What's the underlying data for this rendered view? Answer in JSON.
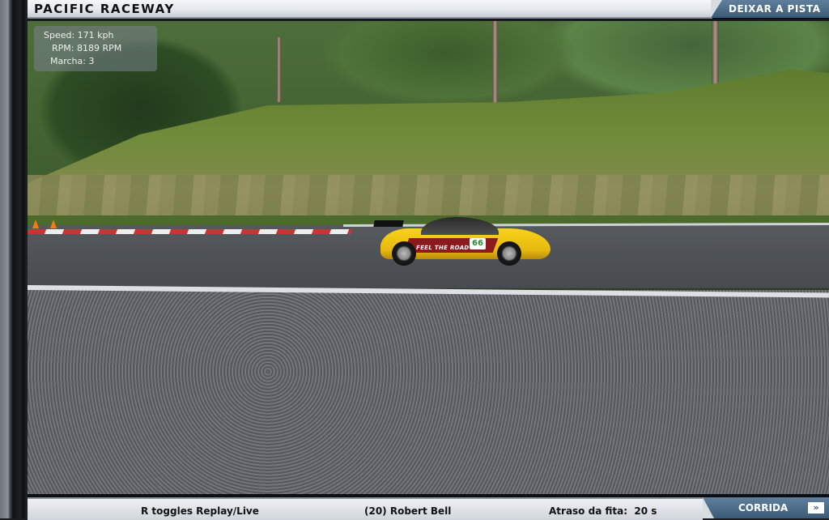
{
  "header": {
    "track_name": "PACIFIC RACEWAY",
    "leave_button": "DEIXAR A PISTA"
  },
  "hud": {
    "speed": "Speed: 171 kph",
    "rpm": "RPM: 8189 RPM",
    "gear": "Marcha: 3"
  },
  "car": {
    "number": "66",
    "livery_text": "FEEL THE ROAD"
  },
  "footer": {
    "replay_hint": "R toggles Replay/Live",
    "driver": "(20) Robert Bell",
    "tape_delay": "Atraso da fita:  20 s",
    "race_button": "CORRIDA",
    "race_arrow_icon": "double-chevron-right-icon"
  }
}
